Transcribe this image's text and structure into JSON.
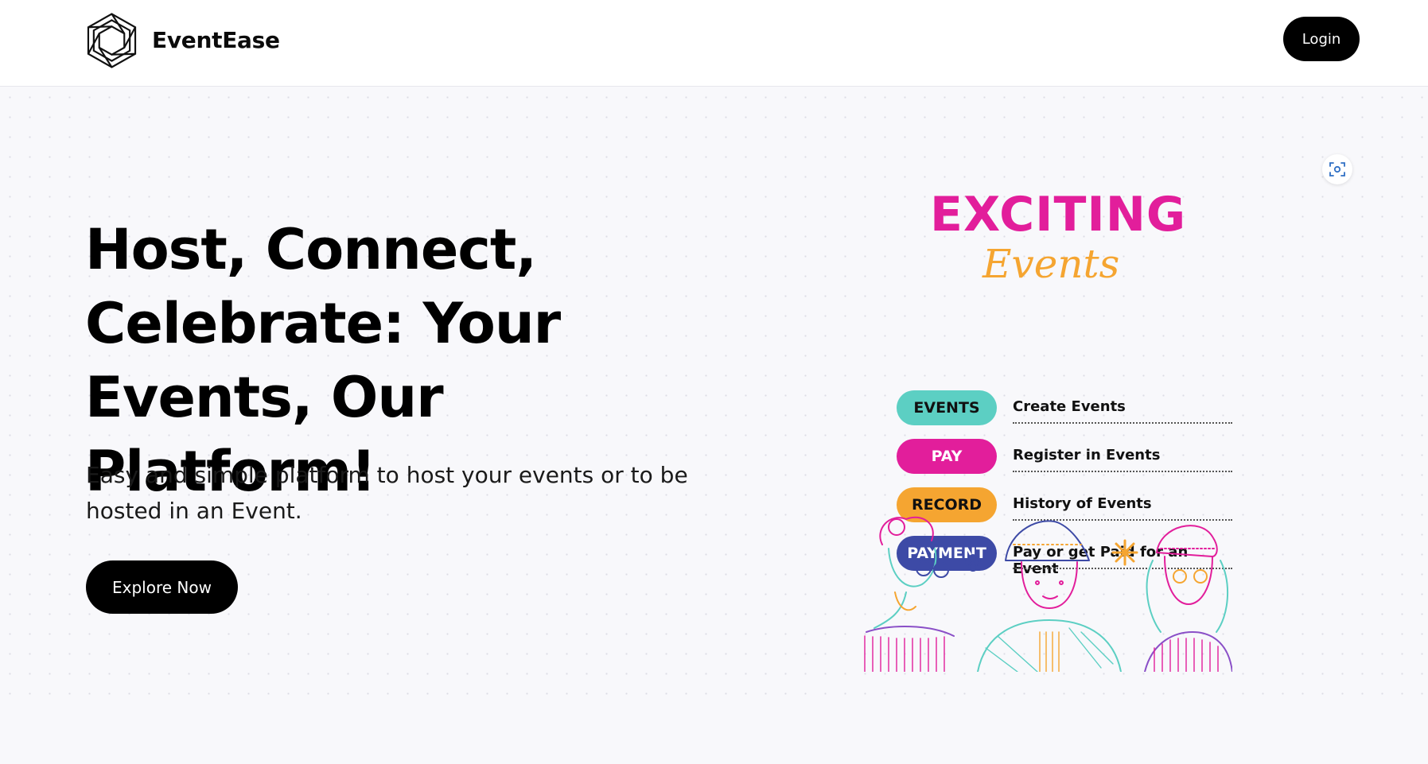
{
  "navbar": {
    "brand_name": "EventEase",
    "login_label": "Login",
    "logo_icon": "hexagon-logo-icon"
  },
  "hero": {
    "title": "Host, Connect, Celebrate: Your Events, Our Platform!",
    "subtitle": "Easy and simple platform to host your events or to be hosted in an Event.",
    "cta_label": "Explore Now",
    "scan_icon": "scan-focus-icon"
  },
  "poster": {
    "title": "EXCITING",
    "script_title": "Events",
    "features": [
      {
        "tag": "EVENTS",
        "text": "Create Events",
        "color": "#5ccfc3",
        "text_color": "#111111"
      },
      {
        "tag": "PAY",
        "text": "Register in Events",
        "color": "#e21e9b",
        "text_color": "#ffffff"
      },
      {
        "tag": "RECORD",
        "text": "History of Events",
        "color": "#f5a531",
        "text_color": "#111111"
      },
      {
        "tag": "PAYMENT",
        "text": "Pay or get Paid for an Event",
        "color": "#3d4aa6",
        "text_color": "#ffffff"
      }
    ],
    "illustration": "three-people-line-art-illustration"
  },
  "colors": {
    "background": "#f8f8fb",
    "button": "#000000",
    "accent_pink": "#e21e9b",
    "accent_orange": "#f5a531",
    "accent_teal": "#5ccfc3",
    "accent_blue": "#3d4aa6"
  }
}
